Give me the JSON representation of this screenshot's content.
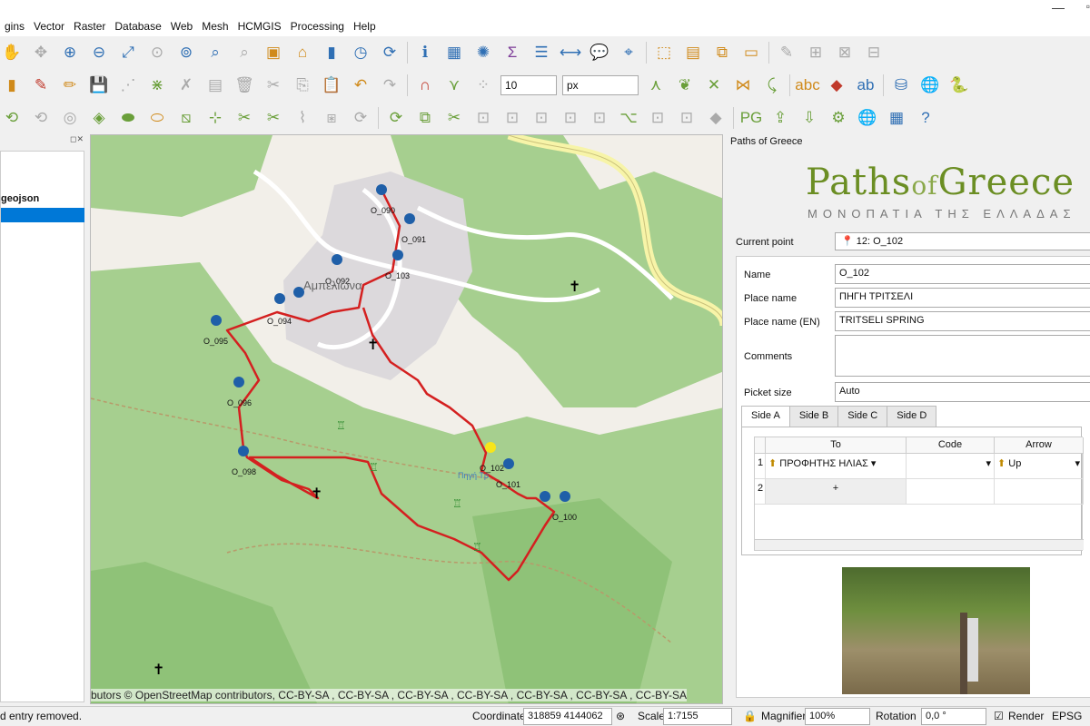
{
  "menu": [
    "gins",
    "Vector",
    "Raster",
    "Database",
    "Web",
    "Mesh",
    "HCMGIS",
    "Processing",
    "Help"
  ],
  "toolbar2": {
    "size_value": "10",
    "unit": "px"
  },
  "layers_panel": {
    "layer_name": "geojson"
  },
  "map": {
    "attribution": "butors © OpenStreetMap contributors, CC-BY-SA , CC-BY-SA , CC-BY-SA , CC-BY-SA , CC-BY-SA , CC-BY-SA , CC-BY-SA",
    "village_label": "Αμπελιώνα",
    "spring_label": "Πηγή Τρ",
    "points": [
      "O_090",
      "O_091",
      "O_092",
      "O_103",
      "O_094",
      "O_095",
      "O_096",
      "O_098",
      "O_102",
      "O_101",
      "O_100"
    ]
  },
  "panel": {
    "title": "Paths of Greece",
    "logo_main": "Paths",
    "logo_of": "of",
    "logo_end": "Greece",
    "logo_sub": "ΜΟΝΟΠΑΤΙΑ ΤΗΣ ΕΛΛΑΔΑΣ",
    "current_point_label": "Current point",
    "current_point_value": "12: O_102",
    "fields": {
      "name_label": "Name",
      "name_value": "O_102",
      "place_label": "Place name",
      "place_value": "ΠΗΓΗ ΤΡΙΤΣΕΛΙ",
      "place_en_label": "Place name (EN)",
      "place_en_value": "TRITSELI SPRING",
      "comments_label": "Comments",
      "comments_value": "",
      "picket_label": "Picket size",
      "picket_value": "Auto"
    },
    "tabs": [
      "Side A",
      "Side B",
      "Side C",
      "Side D"
    ],
    "table": {
      "headers": [
        "To",
        "Code",
        "Arrow"
      ],
      "row1": {
        "num": "1",
        "to": "ΠΡΟΦΗΤΗΣ ΗΛΙΑΣ",
        "code": "",
        "arrow": "Up"
      },
      "row2": {
        "num": "2",
        "add": "+"
      }
    }
  },
  "status": {
    "message": "d entry removed.",
    "coordinate_label": "Coordinate",
    "coordinate_value": "318859 4144062",
    "scale_label": "Scale",
    "scale_value": "1:7155",
    "magnifier_label": "Magnifier",
    "magnifier_value": "100%",
    "rotation_label": "Rotation",
    "rotation_value": "0,0 °",
    "render_label": "Render",
    "crs_label": "EPSG"
  }
}
